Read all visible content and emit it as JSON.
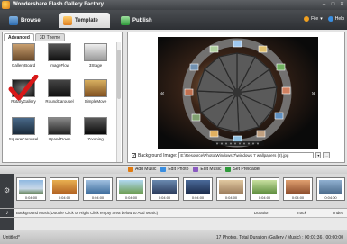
{
  "window": {
    "title": "Wondershare Flash Gallery Factory"
  },
  "toolbar": {
    "tabs": [
      {
        "label": "Browse"
      },
      {
        "label": "Template"
      },
      {
        "label": "Publish"
      }
    ],
    "file_label": "File",
    "help_label": "Help"
  },
  "template_panel": {
    "subtabs": [
      "Advanced",
      "3D Theme"
    ],
    "templates": [
      {
        "label": "GalleryBoard"
      },
      {
        "label": "ImageFlow"
      },
      {
        "label": "3Stage"
      },
      {
        "label": "RotaryGallery"
      },
      {
        "label": "RoundCarousel"
      },
      {
        "label": "SimpleMove"
      },
      {
        "label": "SquareCarousel"
      },
      {
        "label": "UpandDown"
      },
      {
        "label": "Zooming"
      }
    ],
    "selected": "RotaryGallery"
  },
  "preview": {
    "background_label": "Background Image:",
    "background_path": "E:\\Resource\\Photo\\Windows 7\\windows 7 wallpapers (2).jpg",
    "background_checked": true
  },
  "timeline_toolbar": {
    "add_music": "Add Music",
    "edit_photo": "Edit Photo",
    "edit_music": "Edit Music",
    "set_preloader": "Set Preloader"
  },
  "photos": [
    {
      "label": "0:04:00"
    },
    {
      "label": "0:04:00"
    },
    {
      "label": "0:04:00"
    },
    {
      "label": "0:04:00"
    },
    {
      "label": "0:04:00"
    },
    {
      "label": "0:04:00"
    },
    {
      "label": "0:04:00"
    },
    {
      "label": "0:04:00"
    },
    {
      "label": "0:04:00"
    },
    {
      "label": "0:04:00"
    },
    {
      "label": "0:04:00"
    }
  ],
  "music": {
    "hint": "Background Music(Double Click or Right Click empty area below to Add Music)",
    "col_duration": "Duration",
    "col_track": "Track",
    "col_index": "Index"
  },
  "status": {
    "left": "Untitled*",
    "right": "17 Photos, Total Duration (Gallery / Music) : 00:01:36 / 00:00:00"
  },
  "colors": {
    "titlebar": "#3e4145",
    "accent_orange": "#e07a10",
    "check_red": "#d81818"
  }
}
